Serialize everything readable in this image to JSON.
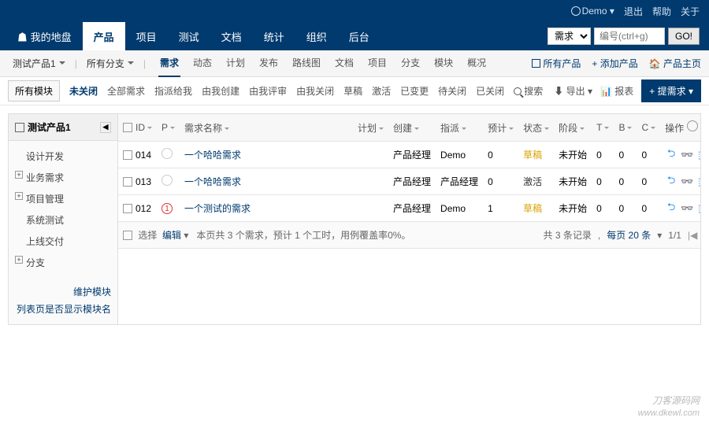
{
  "topbar": {
    "user": "Demo",
    "logout": "退出",
    "help": "帮助",
    "about": "关于"
  },
  "mainnav": {
    "items": [
      "我的地盘",
      "产品",
      "项目",
      "测试",
      "文档",
      "统计",
      "组织",
      "后台"
    ],
    "active_index": 1,
    "search_type": "需求",
    "search_placeholder": "编号(ctrl+g)",
    "go": "GO!"
  },
  "subnav": {
    "product": "测试产品1",
    "branch": "所有分支",
    "tabs": [
      "需求",
      "动态",
      "计划",
      "发布",
      "路线图",
      "文档",
      "项目",
      "分支",
      "模块",
      "概况"
    ],
    "active_tab": 0,
    "all_products": "所有产品",
    "add_product": "添加产品",
    "product_home": "产品主页"
  },
  "filterbar": {
    "all_modules": "所有模块",
    "filters": [
      "未关闭",
      "全部需求",
      "指派给我",
      "由我创建",
      "由我评审",
      "由我关闭",
      "草稿",
      "激活",
      "已变更",
      "待关闭",
      "已关闭"
    ],
    "active_filter": 0,
    "search": "搜索",
    "export": "导出",
    "report": "报表",
    "submit": "提需求"
  },
  "sidebar": {
    "product_name": "测试产品1",
    "nodes": [
      {
        "label": "设计开发",
        "expandable": false
      },
      {
        "label": "业务需求",
        "expandable": true
      },
      {
        "label": "项目管理",
        "expandable": true
      },
      {
        "label": "系统测试",
        "expandable": false
      },
      {
        "label": "上线交付",
        "expandable": false
      },
      {
        "label": "分支",
        "expandable": true
      }
    ],
    "maintain": "维护模块",
    "show_names": "列表页是否显示模块名"
  },
  "table": {
    "headers": {
      "id": "ID",
      "pri": "P",
      "title": "需求名称",
      "plan": "计划",
      "creator": "创建",
      "assigned": "指派",
      "estimate": "预计",
      "status": "状态",
      "stage": "阶段",
      "t": "T",
      "b": "B",
      "c": "C",
      "actions": "操作"
    },
    "rows": [
      {
        "id": "014",
        "pri": "",
        "pri_red": false,
        "title": "一个哈哈需求",
        "plan": "",
        "creator": "产品经理",
        "assigned": "Demo",
        "estimate": "0",
        "status": "草稿",
        "status_cls": "draft",
        "stage": "未开始",
        "t": "0",
        "b": "0",
        "c": "0"
      },
      {
        "id": "013",
        "pri": "",
        "pri_red": false,
        "title": "一个哈哈需求",
        "plan": "",
        "creator": "产品经理",
        "assigned": "产品经理",
        "estimate": "0",
        "status": "激活",
        "status_cls": "active",
        "stage": "未开始",
        "t": "0",
        "b": "0",
        "c": "0"
      },
      {
        "id": "012",
        "pri": "1",
        "pri_red": true,
        "title": "一个测试的需求",
        "plan": "",
        "creator": "产品经理",
        "assigned": "Demo",
        "estimate": "1",
        "status": "草稿",
        "status_cls": "draft",
        "stage": "未开始",
        "t": "0",
        "b": "0",
        "c": "0"
      }
    ],
    "footer": {
      "select": "选择",
      "edit": "编辑",
      "summary": "本页共 3 个需求，预计 1 个工时，用例覆盖率0%。",
      "total": "共 3 条记录",
      "per_page": "每页 20 条",
      "page": "1/1"
    }
  },
  "watermark": {
    "brand": "刀客源码网",
    "url": "www.dkewl.com"
  }
}
